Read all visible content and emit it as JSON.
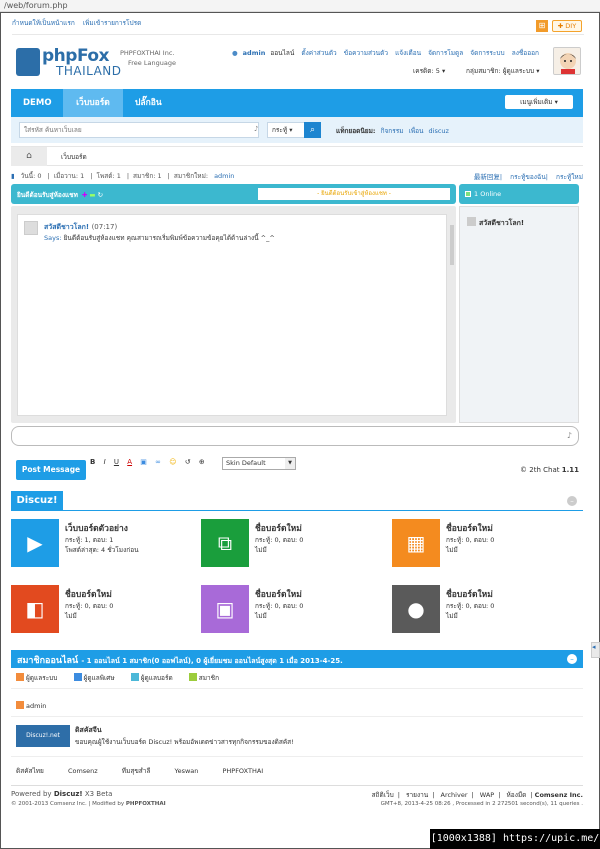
{
  "url": "/web/forum.php",
  "topbar": {
    "set_home": "กำหนดให้เป็นหน้าแรก",
    "add_favorite": "เพิ่มเข้ารายการโปรด",
    "diy": "DIY"
  },
  "brand": {
    "logo_top": "phpFox",
    "logo_bottom": "THAILAND",
    "sub_line1": "PHPFOXTHAI Inc.",
    "sub_line2": "Free Language"
  },
  "usernav": {
    "username": "admin",
    "status": "ออนไลน์",
    "items": [
      "ตั้งค่าส่วนตัว",
      "ข้อความส่วนตัว",
      "แจ้งเตือน",
      "จัดการโมดูล",
      "จัดการระบบ",
      "ลงชื่อออก"
    ],
    "credit": "เครดิต: 5",
    "group": "กลุ่มสมาชิก: ผู้ดูแลระบบ"
  },
  "nav": {
    "items": [
      "DEMO",
      "เว็บบอร์ด",
      "ปลั๊กอิน"
    ],
    "active_index": 1,
    "quick": "เมนูเพิ่มเติม"
  },
  "search": {
    "placeholder": "ใส่รหัส ค้นหาเว็บเลย",
    "scope": "กระทู้",
    "hot_label": "แท็กยอดนิยม:",
    "hot_tags": [
      "กิจกรรม",
      "เพื่อน",
      "discuz"
    ]
  },
  "breadcrumb": {
    "current": "เว็บบอร์ด"
  },
  "stats": {
    "today": "วันนี้: 0",
    "yesterday": "เมื่อวาน: 1",
    "posts": "โพสต์: 1",
    "members": "สมาชิก: 1",
    "new_member_label": "สมาชิกใหม่:",
    "new_member": "admin",
    "right": [
      "最新回复",
      "กระทู้ของฉัน",
      "กระทู้ใหม่"
    ]
  },
  "chat": {
    "title": "ยินดีต้อนรับสู่ห้องแชท",
    "notice": "- ยินดีต้อนรับเข้าสู่ห้องแชท -",
    "online": "1 Online",
    "message": {
      "name": "สวัสดีชาวโลก!",
      "time": "(07:17)",
      "says": "Says:",
      "text": "ยินดีต้อนรับสู่ห้องแชท คุณสามารถเริ่มพิมพ์ข้อความข้อคุยได้ด้านล่างนี้ ^_^"
    },
    "online_user": "สวัสดีชาวโลก!",
    "post_button": "Post Message",
    "tools": [
      "B",
      "I",
      "U",
      "A"
    ],
    "skin": "Skin Default",
    "version_prefix": "© 2th Chat",
    "version": "1.11"
  },
  "discuz": {
    "title": "Discuz!",
    "forums": [
      {
        "title": "เว็บบอร์ดตัวอย่าง",
        "stat": "กระทู้: 1, ตอบ: 1",
        "last": "โพสต์ล่าสุด: 4 ชั่วโมงก่อน",
        "color": "#1e9de6",
        "icon": "play-icon",
        "glyph": "▶"
      },
      {
        "title": "ชื่อบอร์ดใหม่",
        "stat": "กระทู้: 0, ตอบ: 0",
        "last": "ไม่มี",
        "color": "#1a9e3c",
        "icon": "square-icon",
        "glyph": "⧉"
      },
      {
        "title": "ชื่อบอร์ดใหม่",
        "stat": "กระทู้: 0, ตอบ: 0",
        "last": "ไม่มี",
        "color": "#f48b1f",
        "icon": "grid-icon",
        "glyph": "▦"
      },
      {
        "title": "ชื่อบอร์ดใหม่",
        "stat": "กระทู้: 0, ตอบ: 0",
        "last": "ไม่มี",
        "color": "#e24a1f",
        "icon": "office-icon",
        "glyph": "◧"
      },
      {
        "title": "ชื่อบอร์ดใหม่",
        "stat": "กระทู้: 0, ตอบ: 0",
        "last": "ไม่มี",
        "color": "#a86ad8",
        "icon": "photo-icon",
        "glyph": "▣"
      },
      {
        "title": "ชื่อบอร์ดใหม่",
        "stat": "กระทู้: 0, ตอบ: 0",
        "last": "ไม่มี",
        "color": "#5a5a5a",
        "icon": "video-icon",
        "glyph": "●"
      }
    ]
  },
  "online_members": {
    "title": "สมาชิกออนไลน์",
    "summary": "- 1 ออนไลน์   1 สมาชิก(0 ออฟไลน์), 0 ผู้เยี่ยมชม  ออนไลน์สูงสุด  1 เมื่อ 2013-4-25.",
    "legend": [
      {
        "label": "ผู้ดูแลระบบ",
        "color": "#f28c3c"
      },
      {
        "label": "ผู้ดูแลพิเศษ",
        "color": "#3c8ce0"
      },
      {
        "label": "ผู้ดูแลบอร์ด",
        "color": "#4cb8d8"
      },
      {
        "label": "สมาชิก",
        "color": "#9ccc3c"
      }
    ],
    "users": [
      "admin"
    ]
  },
  "ad": {
    "logo": "Discuz!.net",
    "title": "ดิสคัสจีน",
    "text": "ขอบคุณผู้ใช้งานเว็บบอร์ด Discuz! พร้อมอัพเดตข่าวสารทุกกิจกรรมของดิสคัส!"
  },
  "links": [
    "ดิสคัสไทย",
    "Comsenz",
    "ทีมสุขสำลี",
    "Yeswan",
    "PHPFOXTHAI"
  ],
  "footer": {
    "powered": "Powered by",
    "product": "Discuz!",
    "ver": "X3 Beta",
    "copyright": "© 2001-2013 Comsenz Inc. | Modified by",
    "modifier": "PHPFOXTHAI",
    "right_links": [
      "สถิติเว็บ",
      "|",
      "รายงาน",
      "|",
      "Archiver",
      "|",
      "WAP",
      "|",
      "ห้องมืด",
      "|"
    ],
    "company": "Comsenz Inc.",
    "processed": "GMT+8, 2013-4-25 08:26 , Processed in 2 272501 second(s), 11 queries ."
  },
  "watermark": "[1000x1388] https://upic.me/"
}
